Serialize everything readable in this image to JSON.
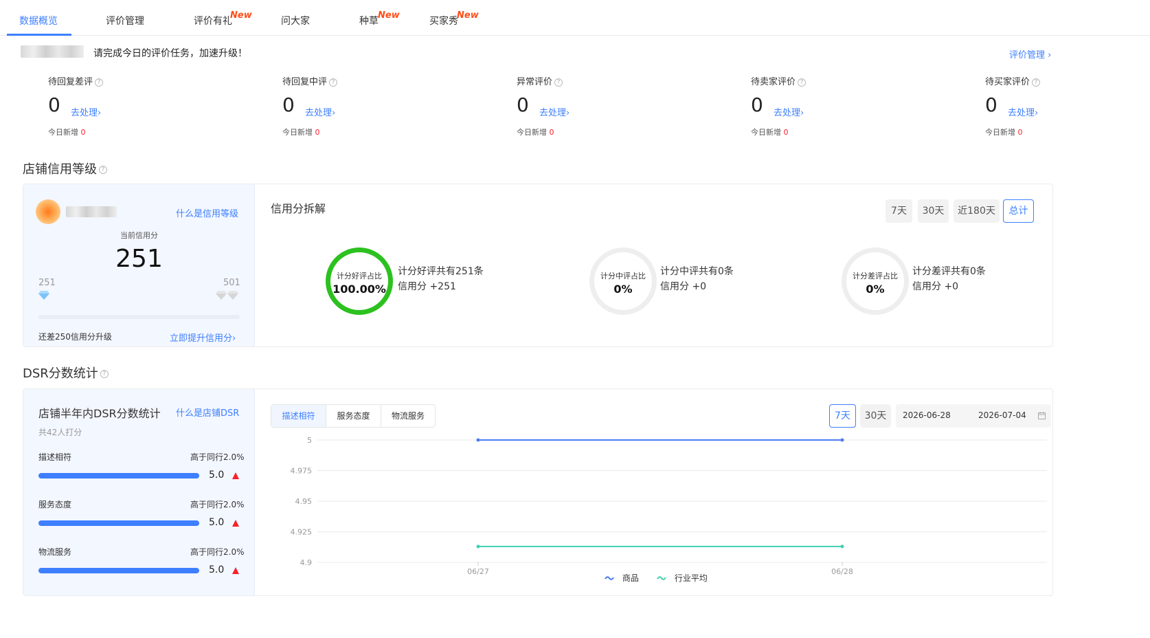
{
  "tabs": [
    {
      "label": "数据概览",
      "active": true,
      "new": ""
    },
    {
      "label": "评价管理",
      "active": false,
      "new": ""
    },
    {
      "label": "评价有礼",
      "active": false,
      "new": "New"
    },
    {
      "label": "问大家",
      "active": false,
      "new": ""
    },
    {
      "label": "种草",
      "active": false,
      "new": "New"
    },
    {
      "label": "买家秀",
      "active": false,
      "new": "New"
    }
  ],
  "header": {
    "task_text": "请完成今日的评价任务，加速升级！",
    "manage_link": "评价管理 ›"
  },
  "stats": [
    {
      "label": "待回复差评",
      "value": "0",
      "action": "去处理›",
      "today_label": "今日新增",
      "today_value": "0"
    },
    {
      "label": "待回复中评",
      "value": "0",
      "action": "去处理›",
      "today_label": "今日新增",
      "today_value": "0"
    },
    {
      "label": "异常评价",
      "value": "0",
      "action": "去处理›",
      "today_label": "今日新增",
      "today_value": "0"
    },
    {
      "label": "待卖家评价",
      "value": "0",
      "action": "去处理›",
      "today_label": "今日新增",
      "today_value": "0"
    },
    {
      "label": "待买家评价",
      "value": "0",
      "action": "去处理›",
      "today_label": "今日新增",
      "today_value": "0"
    }
  ],
  "credit": {
    "section_title": "店铺信用等级",
    "what_link": "什么是信用等级",
    "current_label": "当前信用分",
    "current_value": "251",
    "range_min": "251",
    "range_max": "501",
    "progress": 0.0,
    "gap_text": "还差250信用分升级",
    "boost_link": "立即提升信用分›",
    "breakdown_title": "信用分拆解",
    "periods": [
      {
        "label": "7天",
        "active": false
      },
      {
        "label": "30天",
        "active": false
      },
      {
        "label": "近180天",
        "active": false
      },
      {
        "label": "总计",
        "active": true
      }
    ],
    "rings": [
      {
        "label": "计分好评占比",
        "value": "100.00%",
        "line1": "计分好评共有251条",
        "line2": "信用分 +251",
        "ratio": 1.0
      },
      {
        "label": "计分中评占比",
        "value": "0%",
        "line1": "计分中评共有0条",
        "line2": "信用分 +0",
        "ratio": 0.0
      },
      {
        "label": "计分差评占比",
        "value": "0%",
        "line1": "计分差评共有0条",
        "line2": "信用分 +0",
        "ratio": 0.0
      }
    ]
  },
  "dsr": {
    "section_title": "DSR分数统计",
    "card_title": "店铺半年内DSR分数统计",
    "what_link": "什么是店铺DSR",
    "raters": "共42人打分",
    "rows": [
      {
        "label": "描述相符",
        "compare": "高于同行2.0%",
        "score": "5.0"
      },
      {
        "label": "服务态度",
        "compare": "高于同行2.0%",
        "score": "5.0"
      },
      {
        "label": "物流服务",
        "compare": "高于同行2.0%",
        "score": "5.0"
      }
    ],
    "segments": [
      {
        "label": "描述相符",
        "active": true
      },
      {
        "label": "服务态度",
        "active": false
      },
      {
        "label": "物流服务",
        "active": false
      }
    ],
    "periods": [
      {
        "label": "7天",
        "active": true
      },
      {
        "label": "30天",
        "active": false
      }
    ],
    "date_start": "2026-06-28",
    "date_end": "2026-07-04",
    "colors": {
      "product": "#4a7bf7",
      "industry": "#3fd1b0"
    }
  },
  "chart_data": {
    "type": "line",
    "x": [
      "06/27",
      "06/28"
    ],
    "ylim": [
      4.9,
      5
    ],
    "yticks": [
      "5",
      "4.975",
      "4.95",
      "4.925",
      "4.9"
    ],
    "series": [
      {
        "name": "商品",
        "values": [
          5,
          5
        ]
      },
      {
        "name": "行业平均",
        "values": [
          4.913,
          4.913
        ]
      }
    ],
    "legend_position": "bottom-center",
    "grid": true
  }
}
